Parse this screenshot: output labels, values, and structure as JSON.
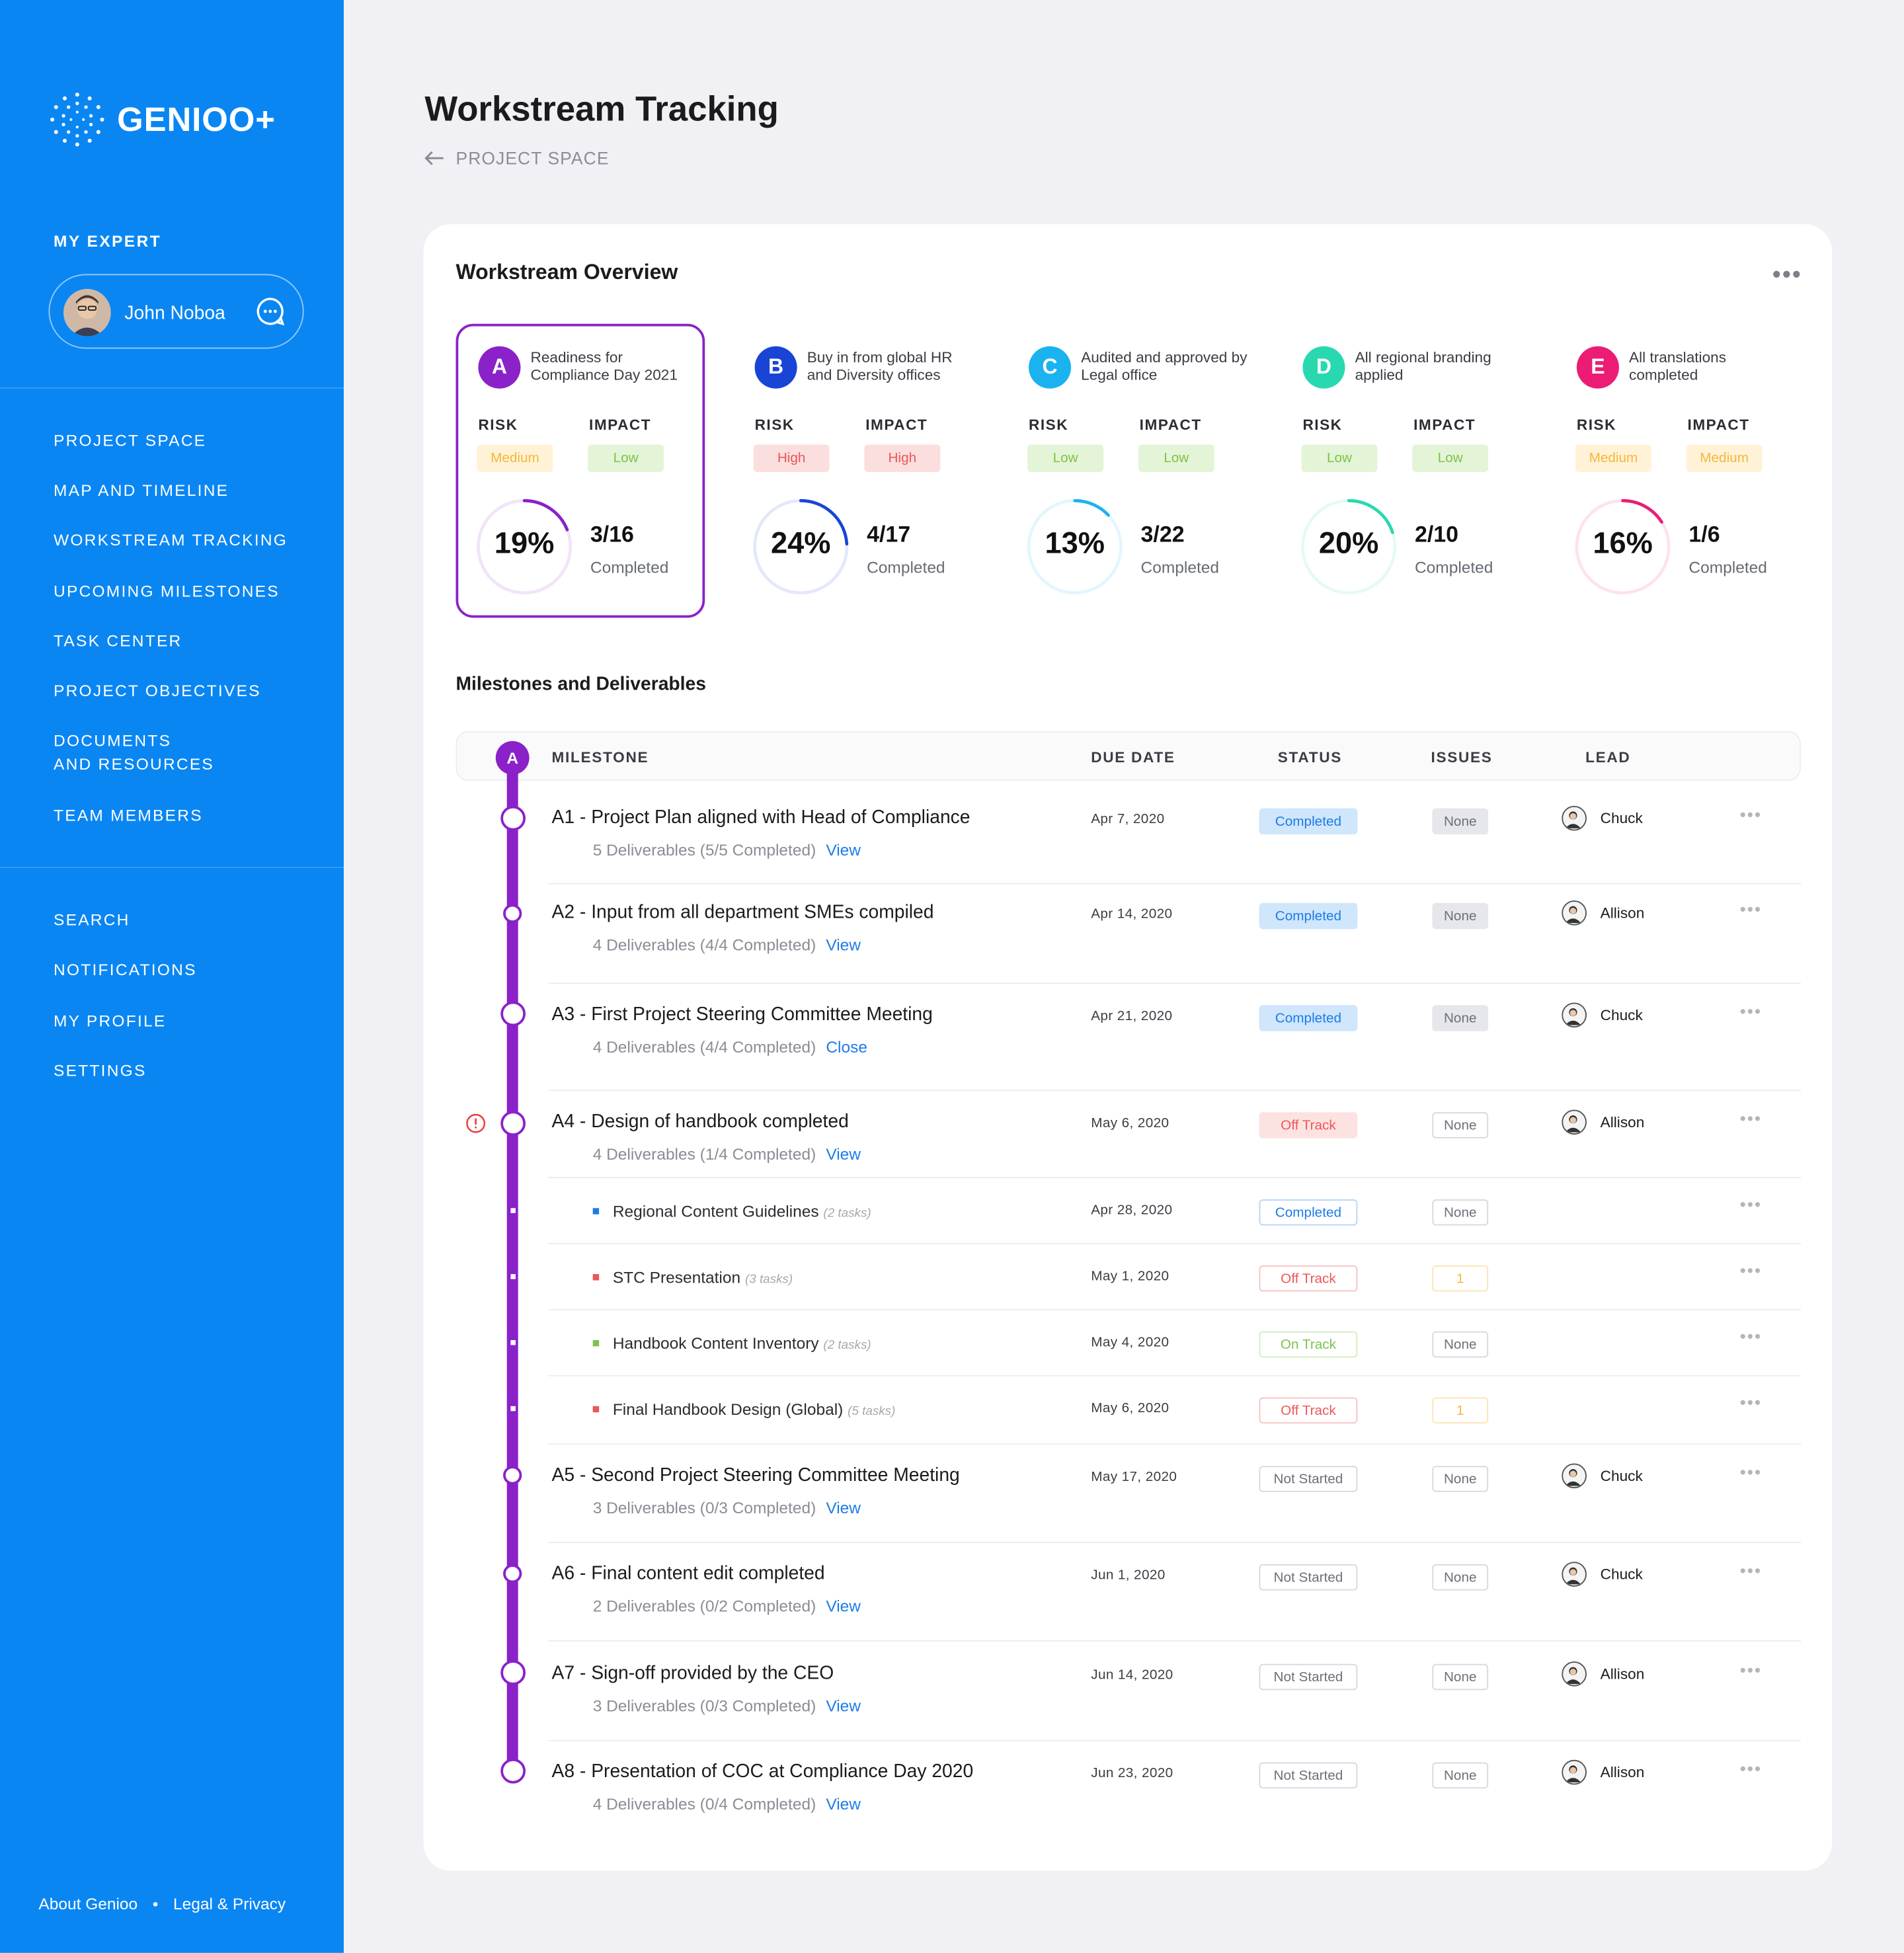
{
  "app": {
    "name": "GENIOO+"
  },
  "sidebar": {
    "expert_label": "MY EXPERT",
    "expert_name": "John Noboa",
    "nav": [
      "PROJECT SPACE",
      "MAP AND TIMELINE",
      "WORKSTREAM TRACKING",
      "UPCOMING MILESTONES",
      "TASK CENTER",
      "PROJECT OBJECTIVES",
      "DOCUMENTS",
      "AND RESOURCES",
      "TEAM MEMBERS"
    ],
    "nav2": [
      "SEARCH",
      "NOTIFICATIONS",
      "MY PROFILE",
      "SETTINGS"
    ],
    "footer": {
      "about": "About Genioo",
      "sep": "•",
      "legal": "Legal & Privacy"
    }
  },
  "header": {
    "title": "Workstream Tracking",
    "back": "PROJECT SPACE"
  },
  "overview": {
    "title": "Workstream Overview",
    "more": "•••",
    "risk_label": "RISK",
    "impact_label": "IMPACT",
    "completed_label": "Completed",
    "workstreams": [
      {
        "letter": "A",
        "desc": "Readiness for Compliance Day 2021",
        "risk": "Medium",
        "impact": "Low",
        "pct": "19%",
        "frac": "3/16",
        "progress": 0.19,
        "color": "#8a21c9"
      },
      {
        "letter": "B",
        "desc": "Buy in from global HR and Diversity offices",
        "risk": "High",
        "impact": "High",
        "pct": "24%",
        "frac": "4/17",
        "progress": 0.24,
        "color": "#1845d6"
      },
      {
        "letter": "C",
        "desc": "Audited and approved by Legal office",
        "risk": "Low",
        "impact": "Low",
        "pct": "13%",
        "frac": "3/22",
        "progress": 0.13,
        "color": "#1ab3f0"
      },
      {
        "letter": "D",
        "desc": "All regional branding applied",
        "risk": "Low",
        "impact": "Low",
        "pct": "20%",
        "frac": "2/10",
        "progress": 0.2,
        "color": "#28d9b0"
      },
      {
        "letter": "E",
        "desc": "All translations completed",
        "risk": "Medium",
        "impact": "Medium",
        "pct": "16%",
        "frac": "1/6",
        "progress": 0.16,
        "color": "#ec1c74"
      }
    ]
  },
  "milestones": {
    "title": "Milestones and Deliverables",
    "group_letter": "A",
    "columns": {
      "milestone": "MILESTONE",
      "due": "DUE DATE",
      "status": "STATUS",
      "issues": "ISSUES",
      "lead": "LEAD"
    },
    "rows": [
      {
        "title": "A1 - Project Plan aligned with Head of Compliance",
        "sub": "5 Deliverables (5/5 Completed)",
        "link": "View",
        "date": "Apr 7, 2020",
        "status": "Completed",
        "issues": "None",
        "lead": "Chuck"
      },
      {
        "title": "A2 - Input from all department SMEs compiled",
        "sub": "4 Deliverables (4/4 Completed)",
        "link": "View",
        "date": "Apr 14, 2020",
        "status": "Completed",
        "issues": "None",
        "lead": "Allison"
      },
      {
        "title": "A3 - First Project Steering Committee Meeting",
        "sub": "4 Deliverables (4/4 Completed)",
        "link": "Close",
        "date": "Apr 21, 2020",
        "status": "Completed",
        "issues": "None",
        "lead": "Chuck"
      },
      {
        "title": "A4 - Design of handbook completed",
        "sub": "4 Deliverables (1/4 Completed)",
        "link": "View",
        "date": "May 6, 2020",
        "status": "Off Track",
        "issues": "None",
        "lead": "Allison"
      },
      {
        "title": "A5 - Second Project Steering Committee Meeting",
        "sub": "3 Deliverables (0/3 Completed)",
        "link": "View",
        "date": "May 17, 2020",
        "status": "Not Started",
        "issues": "None",
        "lead": "Chuck"
      },
      {
        "title": "A6 - Final content edit completed",
        "sub": "2 Deliverables (0/2 Completed)",
        "link": "View",
        "date": "Jun 1, 2020",
        "status": "Not Started",
        "issues": "None",
        "lead": "Chuck"
      },
      {
        "title": "A7 - Sign-off provided by the CEO",
        "sub": "3 Deliverables (0/3 Completed)",
        "link": "View",
        "date": "Jun 14, 2020",
        "status": "Not Started",
        "issues": "None",
        "lead": "Allison"
      },
      {
        "title": "A8 - Presentation of COC at Compliance Day 2020",
        "sub": "4 Deliverables (0/4 Completed)",
        "link": "View",
        "date": "Jun 23, 2020",
        "status": "Not Started",
        "issues": "None",
        "lead": "Allison"
      }
    ],
    "deliverables": [
      {
        "title": "Regional Content Guidelines",
        "tasks": "(2 tasks)",
        "date": "Apr 28, 2020",
        "status": "Completed",
        "issues": "None"
      },
      {
        "title": "STC Presentation",
        "tasks": "(3 tasks)",
        "date": "May 1, 2020",
        "status": "Off Track",
        "issues": "1"
      },
      {
        "title": "Handbook Content Inventory",
        "tasks": "(2 tasks)",
        "date": "May 4, 2020",
        "status": "On Track",
        "issues": "None"
      },
      {
        "title": "Final Handbook Design (Global)",
        "tasks": "(5 tasks)",
        "date": "May 6, 2020",
        "status": "Off Track",
        "issues": "1"
      }
    ],
    "row_more": "•••"
  }
}
